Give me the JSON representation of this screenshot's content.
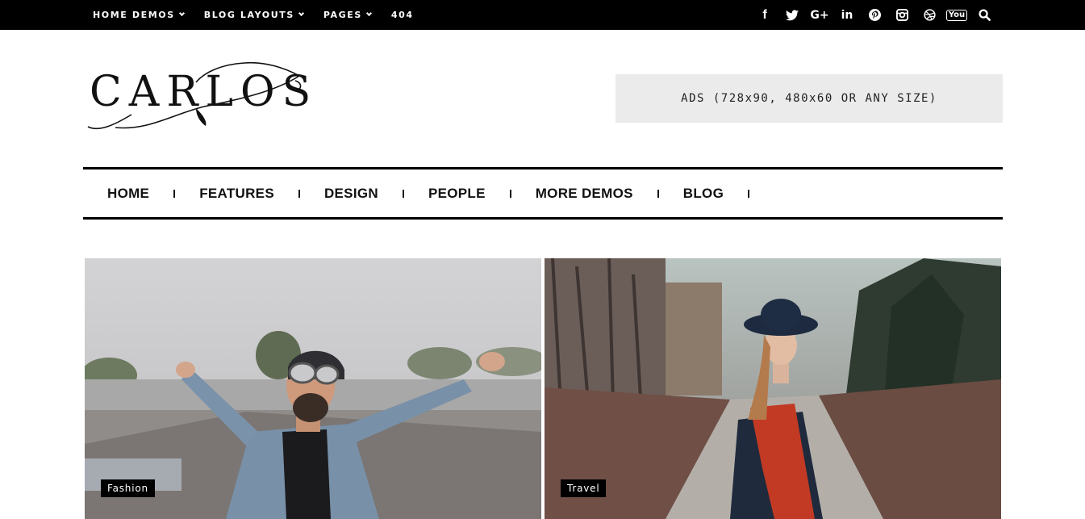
{
  "topbar": {
    "menu": [
      {
        "label": "HOME DEMOS",
        "dropdown": true
      },
      {
        "label": "BLOG LAYOUTS",
        "dropdown": true
      },
      {
        "label": "PAGES",
        "dropdown": true
      },
      {
        "label": "404",
        "dropdown": false
      }
    ],
    "social_icons": [
      "facebook-icon",
      "twitter-icon",
      "google-plus-icon",
      "linkedin-icon",
      "pinterest-icon",
      "instagram-icon",
      "dribbble-icon",
      "youtube-icon",
      "search-icon"
    ],
    "social_glyphs": {
      "facebook": "f",
      "googleplus": "G+",
      "linkedin": "in",
      "youtube": "You"
    }
  },
  "logo": {
    "text": "CARLOS"
  },
  "ad": {
    "text": "ADS (728x90, 480x60 OR ANY SIZE)"
  },
  "nav": {
    "items": [
      "HOME",
      "FEATURES",
      "DESIGN",
      "PEOPLE",
      "MORE DEMOS",
      "BLOG"
    ]
  },
  "cards": [
    {
      "category": "Fashion"
    },
    {
      "category": "Travel"
    }
  ],
  "colors": {
    "topbar": "#000000",
    "ad_bg": "#ebebeb",
    "badge_bg": "#000000",
    "text": "#111111"
  }
}
